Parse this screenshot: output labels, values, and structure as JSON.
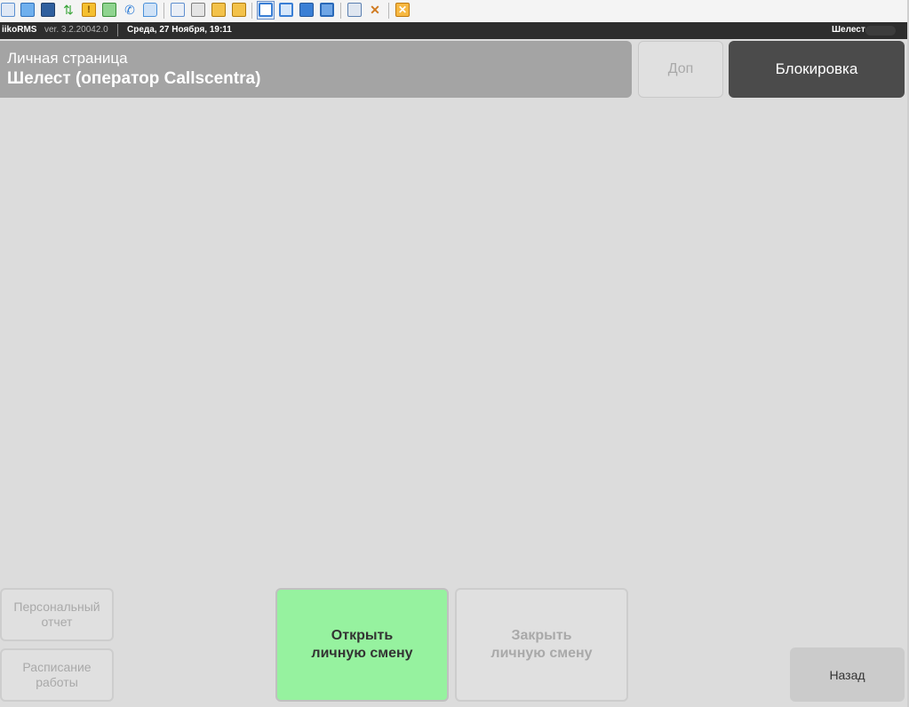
{
  "toolbar": {
    "icons": [
      {
        "name": "calculator-icon",
        "color": "#5a8fd0"
      },
      {
        "name": "monitor-icon",
        "color": "#3f86d6"
      },
      {
        "name": "console-icon",
        "color": "#2f5f9e"
      },
      {
        "name": "sync-arrows-icon",
        "color": "#3aa63a"
      },
      {
        "name": "warning-icon",
        "color": "#f0b020"
      },
      {
        "name": "transfer-icon",
        "color": "#4caf50"
      },
      {
        "name": "phone-icon",
        "color": "#2c7bd6"
      },
      {
        "name": "chat-icon",
        "color": "#4a90d9"
      },
      {
        "name": "user-upload-icon",
        "color": "#5f8fcf"
      },
      {
        "name": "users-icon",
        "color": "#7f7f7f"
      },
      {
        "name": "export-icon",
        "color": "#e3a21a"
      },
      {
        "name": "import-icon",
        "color": "#e3a21a"
      },
      {
        "name": "window-icon",
        "color": "#3a7fd5"
      },
      {
        "name": "fullscreen-icon",
        "color": "#3a7fd5"
      },
      {
        "name": "square-icon",
        "color": "#3a7fd5"
      },
      {
        "name": "expand-icon",
        "color": "#3a7fd5"
      },
      {
        "name": "windows-icon",
        "color": "#5a7fb0"
      },
      {
        "name": "tools-icon",
        "color": "#d07a20"
      },
      {
        "name": "close-icon",
        "color": "#f0a020"
      }
    ]
  },
  "status": {
    "app": "iikoRMS",
    "version": "ver. 3.2.20042.0",
    "datetime": "Среда, 27 Ноября, 19:11",
    "user": "Шелест"
  },
  "header": {
    "subtitle": "Личная страница",
    "name": "Шелест (оператор Callscentra)"
  },
  "buttons": {
    "dop": "Доп",
    "lock": "Блокировка",
    "personal_report": [
      "Персональный",
      "отчет"
    ],
    "schedule": [
      "Расписание",
      "работы"
    ],
    "open_shift": [
      "Открыть",
      "личную смену"
    ],
    "close_shift": [
      "Закрыть",
      "личную смену"
    ],
    "back": "Назад"
  },
  "colors": {
    "header_bg": "#a4a4a4",
    "lock_bg": "#4b4b4b",
    "open_shift_bg": "#96f29f",
    "page_bg": "#dcdcdc"
  }
}
